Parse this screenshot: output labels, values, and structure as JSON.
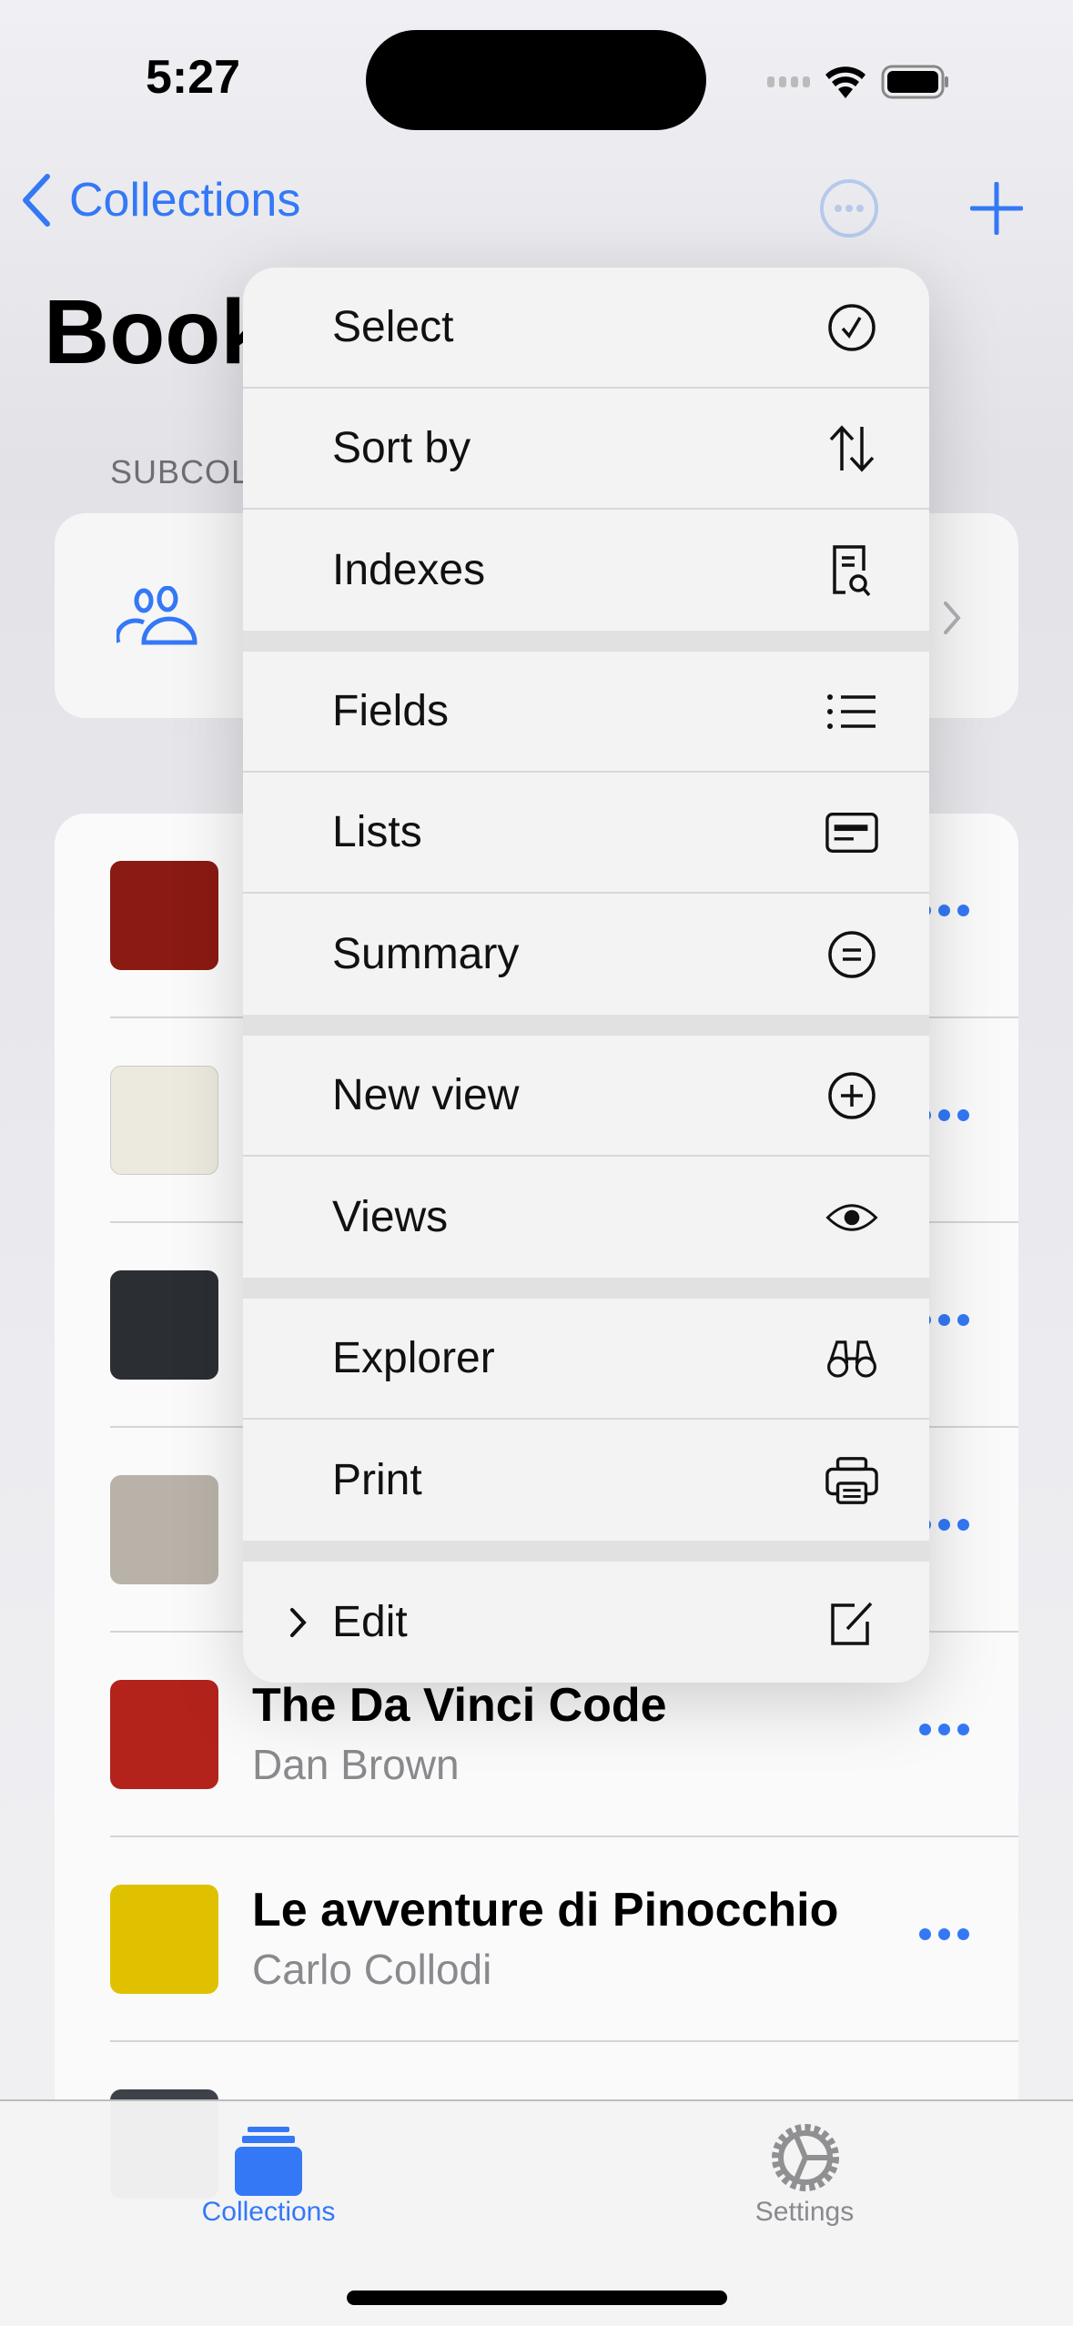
{
  "status_bar": {
    "time": "5:27"
  },
  "nav": {
    "back_label": "Collections"
  },
  "page": {
    "title": "Book",
    "subcollections_header": "SUBCOL"
  },
  "books": [
    {
      "cover_color": "#8a1a12"
    },
    {
      "cover_color": "#eceade"
    },
    {
      "cover_color": "#2b2e33"
    },
    {
      "cover_color": "#b9b2a8"
    },
    {
      "title": "The Da Vinci Code",
      "author": "Dan Brown",
      "cover_color": "#b3231c"
    },
    {
      "title": "Le avventure di Pinocchio",
      "author": "Carlo Collodi",
      "cover_color": "#e0c100"
    },
    {
      "cover_color": "#3c4248"
    }
  ],
  "menu": {
    "items": [
      {
        "label": "Select",
        "icon": "checkmark-circle-icon"
      },
      {
        "label": "Sort by",
        "icon": "arrow-up-down-icon"
      },
      {
        "label": "Indexes",
        "icon": "doc-search-icon"
      },
      {
        "label": "Fields",
        "icon": "list-bullet-icon"
      },
      {
        "label": "Lists",
        "icon": "list-card-icon"
      },
      {
        "label": "Summary",
        "icon": "equal-circle-icon"
      },
      {
        "label": "New view",
        "icon": "plus-circle-icon"
      },
      {
        "label": "Views",
        "icon": "eye-icon"
      },
      {
        "label": "Explorer",
        "icon": "binoculars-icon"
      },
      {
        "label": "Print",
        "icon": "printer-icon"
      },
      {
        "label": "Edit",
        "icon": "square-pencil-icon"
      }
    ]
  },
  "tabbar": {
    "collections": "Collections",
    "settings": "Settings"
  },
  "colors": {
    "accent": "#3478f6",
    "secondary": "#8a8a8e"
  }
}
